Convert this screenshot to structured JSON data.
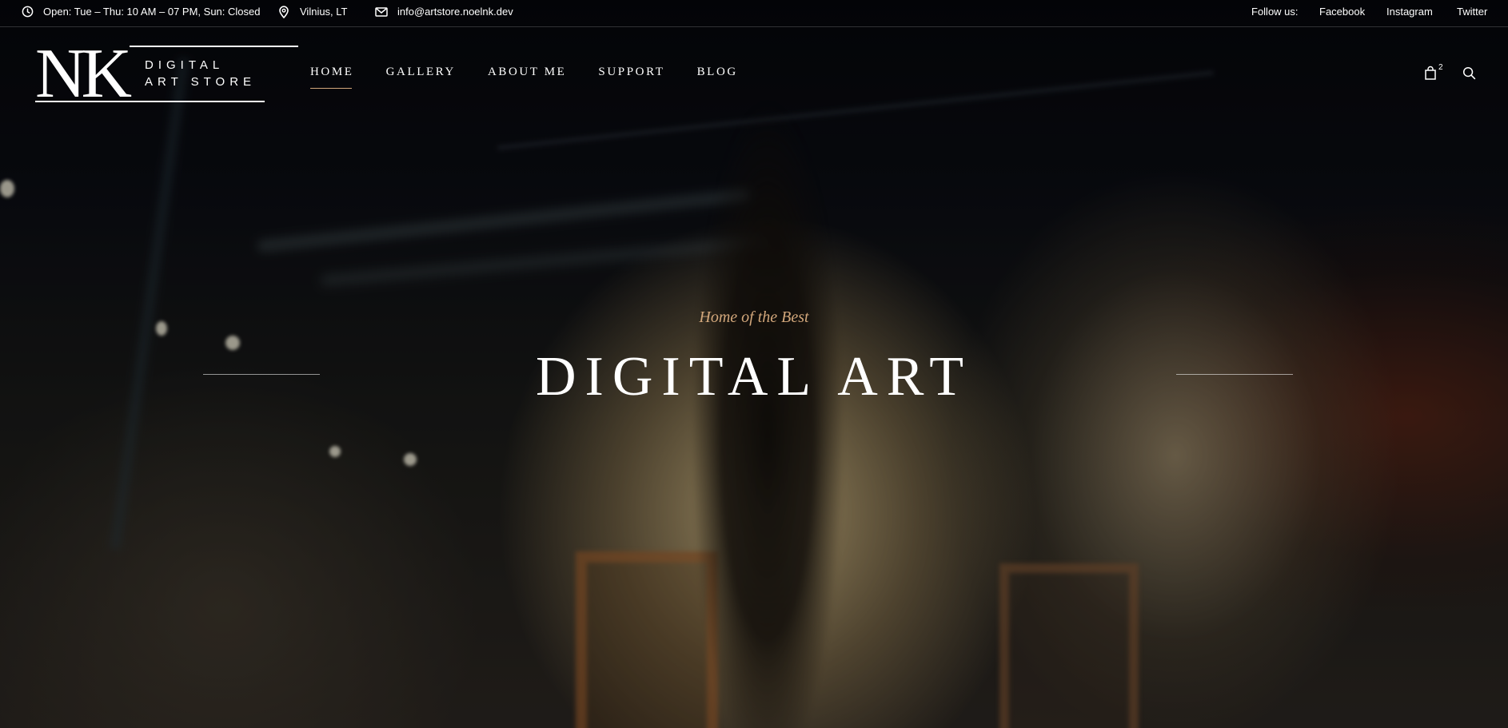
{
  "topbar": {
    "hours": "Open: Tue – Thu: 10 AM – 07 PM, Sun: Closed",
    "location": "Vilnius, LT",
    "email": "info@artstore.noelnk.dev",
    "follow_label": "Follow us:",
    "social": [
      "Facebook",
      "Instagram",
      "Twitter"
    ],
    "icons": [
      "clock-icon",
      "map-pin-icon",
      "envelope-icon"
    ]
  },
  "logo": {
    "mark": "NK",
    "line1": "DIGITAL",
    "line2": "ART STORE"
  },
  "nav": {
    "items": [
      "HOME",
      "GALLERY",
      "ABOUT ME",
      "SUPPORT",
      "BLOG"
    ],
    "active": "HOME"
  },
  "header_actions": {
    "cart_count": "2",
    "icons": [
      "shopping-bag-icon",
      "search-icon"
    ]
  },
  "hero": {
    "subtitle": "Home of the Best",
    "title": "DIGITAL ART"
  },
  "colors": {
    "accent": "#d2a77b",
    "text": "#ffffff",
    "background": "#07080c"
  }
}
